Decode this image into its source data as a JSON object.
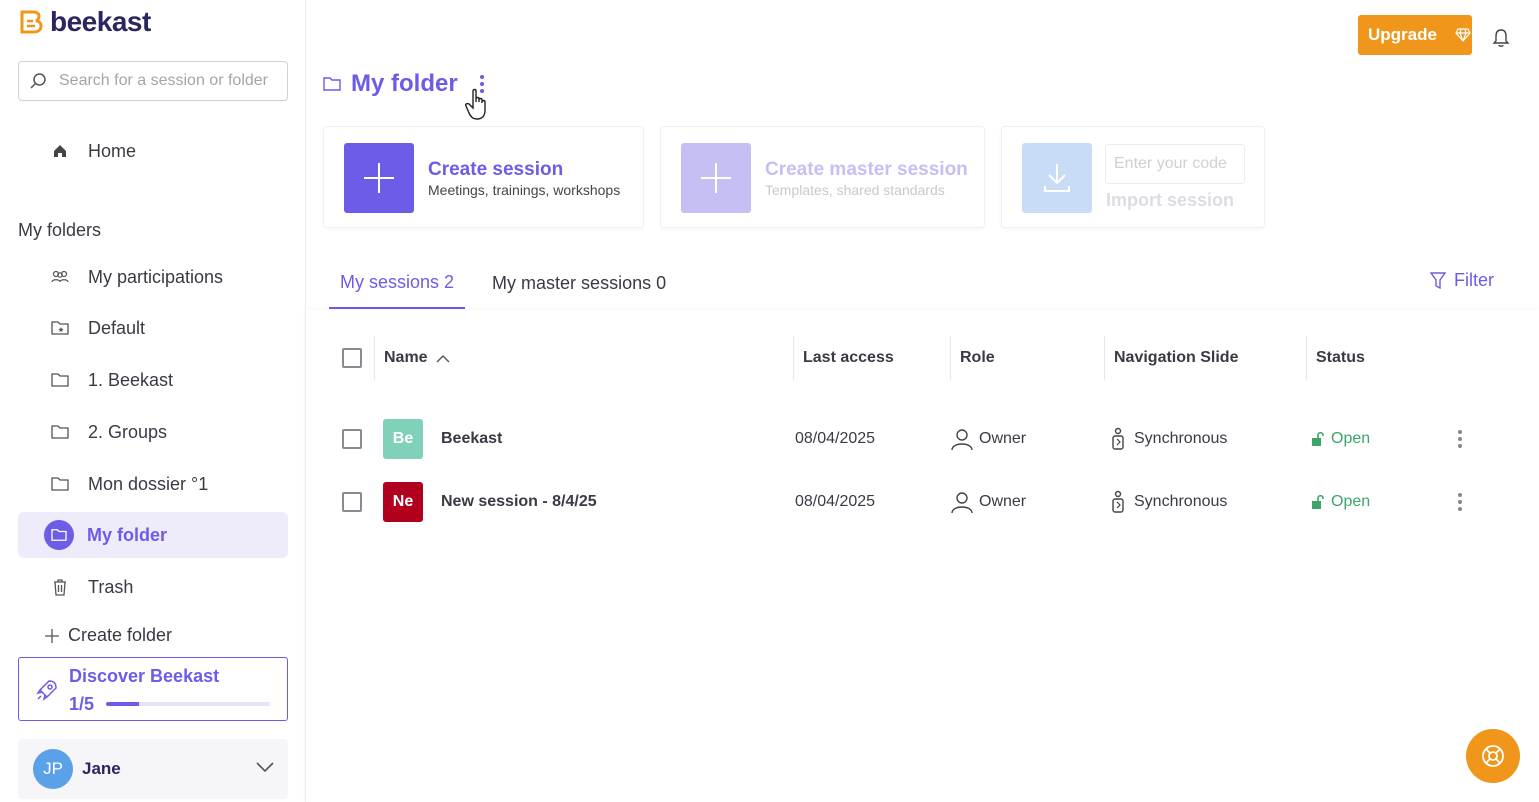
{
  "app": {
    "logo_text": "beekast"
  },
  "search": {
    "placeholder": "Search for a session or folder"
  },
  "nav": {
    "home": "Home",
    "section_label": "My folders",
    "items": [
      {
        "label": "My participations"
      },
      {
        "label": "Default"
      },
      {
        "label": "1. Beekast"
      },
      {
        "label": "2. Groups"
      },
      {
        "label": "Mon dossier °1"
      },
      {
        "label": "My folder"
      },
      {
        "label": "Trash"
      }
    ],
    "create_folder": "Create folder"
  },
  "discover": {
    "title": "Discover Beekast",
    "progress_text": "1/5",
    "progress_fraction": 0.2
  },
  "user": {
    "initials": "JP",
    "name": "Jane"
  },
  "header": {
    "upgrade": "Upgrade"
  },
  "folder": {
    "title": "My folder"
  },
  "cards": {
    "create": {
      "title": "Create session",
      "subtitle": "Meetings, trainings, workshops"
    },
    "master": {
      "title": "Create master session",
      "subtitle": "Templates, shared standards"
    },
    "import": {
      "placeholder": "Enter your code",
      "button": "Import session"
    }
  },
  "tabs": [
    {
      "label": "My sessions 2"
    },
    {
      "label": "My master sessions 0"
    }
  ],
  "filter": "Filter",
  "table": {
    "columns": {
      "name": "Name",
      "last_access": "Last access",
      "role": "Role",
      "nav_slide": "Navigation Slide",
      "status": "Status"
    },
    "rows": [
      {
        "initials": "Be",
        "color": "#7fd1b9",
        "name": "Beekast",
        "last_access": "08/04/2025",
        "role": "Owner",
        "nav_slide": "Synchronous",
        "status": "Open"
      },
      {
        "initials": "Ne",
        "color": "#b0001e",
        "name": "New session - 8/4/25",
        "last_access": "08/04/2025",
        "role": "Owner",
        "nav_slide": "Synchronous",
        "status": "Open"
      }
    ]
  },
  "colors": {
    "accent": "#6c5ce7",
    "orange": "#f0961a",
    "open_green": "#3ca66a"
  }
}
